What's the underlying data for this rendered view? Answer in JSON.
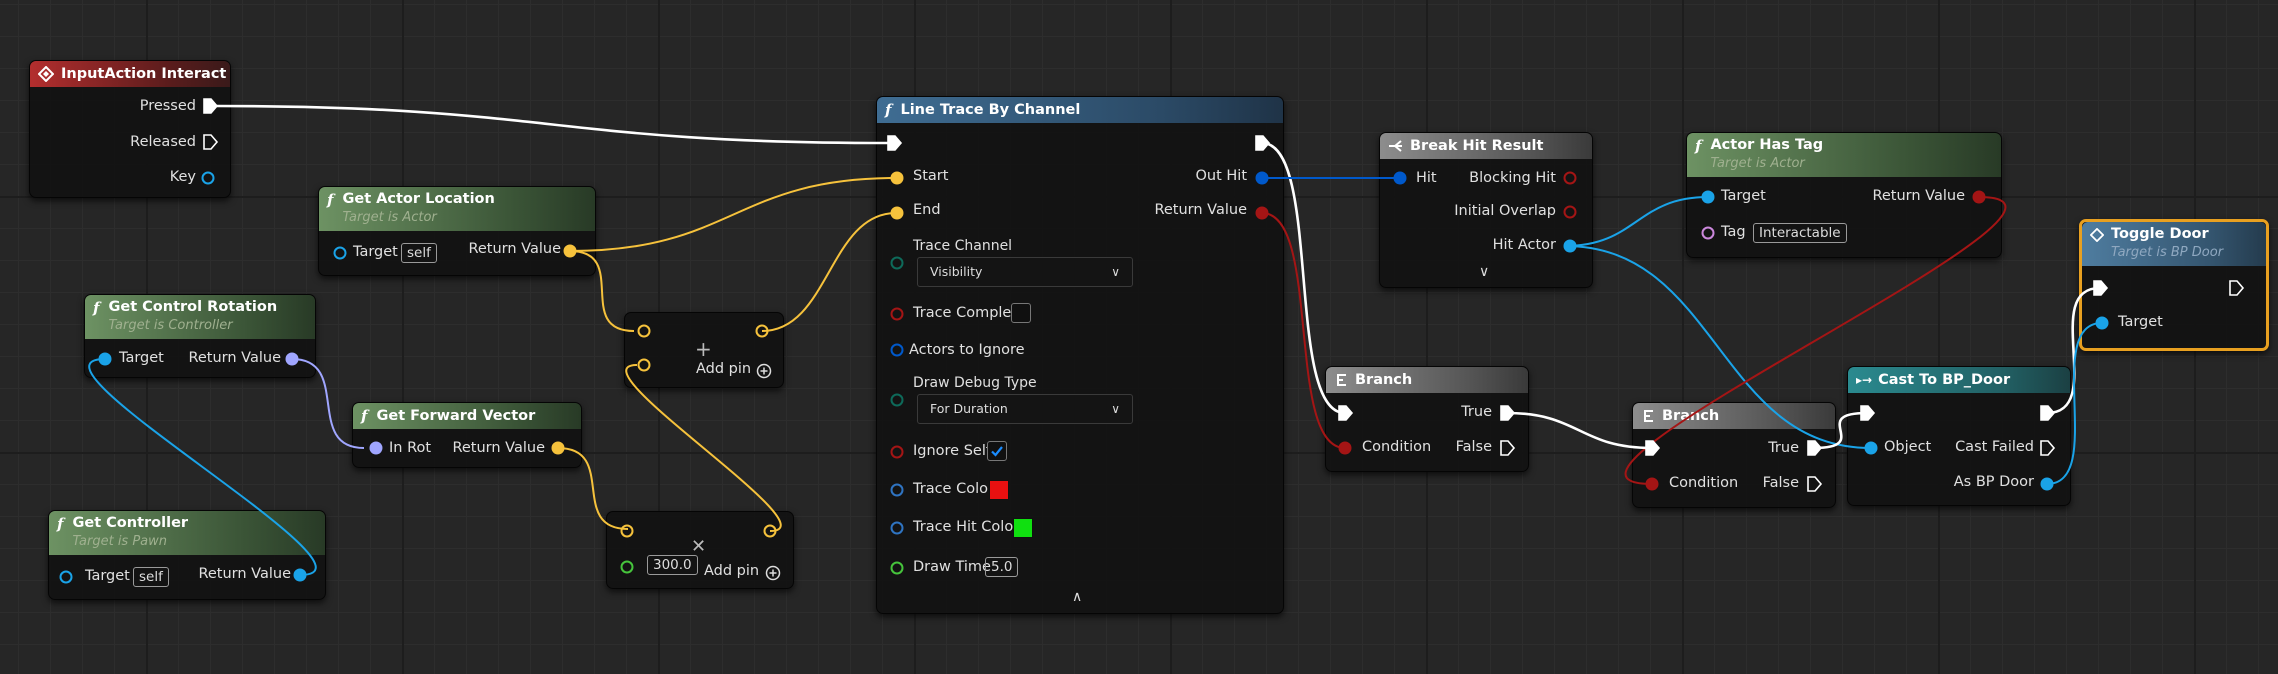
{
  "colors": {
    "exec": "#ffffff",
    "vector": "#f6c23c",
    "rotator": "#a0a6ff",
    "object": "#1aa3e8",
    "bool": "#a41515",
    "struct": "#0059cb",
    "float": "#46c43c",
    "name": "#cc88dd",
    "linear_color": "#2f74c2",
    "enum": "#0e6a5a",
    "header_red": "#b32e2e",
    "header_green": "#6d9263",
    "header_blue": "#3f6d93",
    "selection": "#e8a020"
  },
  "nodes": {
    "input_action": {
      "title": "InputAction Interact",
      "pins": {
        "pressed": "Pressed",
        "released": "Released",
        "key": "Key"
      }
    },
    "get_actor_location": {
      "title": "Get Actor Location",
      "subtitle": "Target is Actor",
      "pins": {
        "target": "Target",
        "target_value": "self",
        "return_value": "Return Value"
      }
    },
    "get_control_rotation": {
      "title": "Get Control Rotation",
      "subtitle": "Target is Controller",
      "pins": {
        "target": "Target",
        "return_value": "Return Value"
      }
    },
    "get_forward_vector": {
      "title": "Get Forward Vector",
      "pins": {
        "in_rot": "In Rot",
        "return_value": "Return Value"
      }
    },
    "get_controller": {
      "title": "Get Controller",
      "subtitle": "Target is Pawn",
      "pins": {
        "target": "Target",
        "target_value": "self",
        "return_value": "Return Value"
      }
    },
    "add_vector": {
      "add_pin": "Add pin"
    },
    "multiply_vector": {
      "constant": "300.0",
      "add_pin": "Add pin"
    },
    "line_trace": {
      "title": "Line Trace By Channel",
      "pins": {
        "start": "Start",
        "end": "End",
        "trace_channel": "Trace Channel",
        "trace_channel_value": "Visibility",
        "trace_complex": "Trace Complex",
        "actors_to_ignore": "Actors to Ignore",
        "draw_debug_type": "Draw Debug Type",
        "draw_debug_type_value": "For Duration",
        "ignore_self": "Ignore Self",
        "trace_color": "Trace Color",
        "trace_color_value": "#e81010",
        "trace_hit_color": "Trace Hit Color",
        "trace_hit_color_value": "#10e010",
        "draw_time": "Draw Time",
        "draw_time_value": "5.0",
        "out_hit": "Out Hit",
        "return_value": "Return Value"
      }
    },
    "break_hit": {
      "title": "Break Hit Result",
      "pins": {
        "hit": "Hit",
        "blocking_hit": "Blocking Hit",
        "initial_overlap": "Initial Overlap",
        "hit_actor": "Hit Actor"
      }
    },
    "actor_has_tag": {
      "title": "Actor Has Tag",
      "subtitle": "Target is Actor",
      "pins": {
        "target": "Target",
        "return_value": "Return Value",
        "tag": "Tag",
        "tag_value": "Interactable"
      }
    },
    "branch_1": {
      "title": "Branch",
      "pins": {
        "condition": "Condition",
        "true": "True",
        "false": "False"
      }
    },
    "branch_2": {
      "title": "Branch",
      "pins": {
        "condition": "Condition",
        "true": "True",
        "false": "False"
      }
    },
    "cast": {
      "title": "Cast To BP_Door",
      "pins": {
        "object": "Object",
        "cast_failed": "Cast Failed",
        "as_bp_door": "As BP Door"
      }
    },
    "toggle_door": {
      "title": "Toggle Door",
      "subtitle": "Target is BP Door",
      "pins": {
        "target": "Target"
      }
    }
  }
}
